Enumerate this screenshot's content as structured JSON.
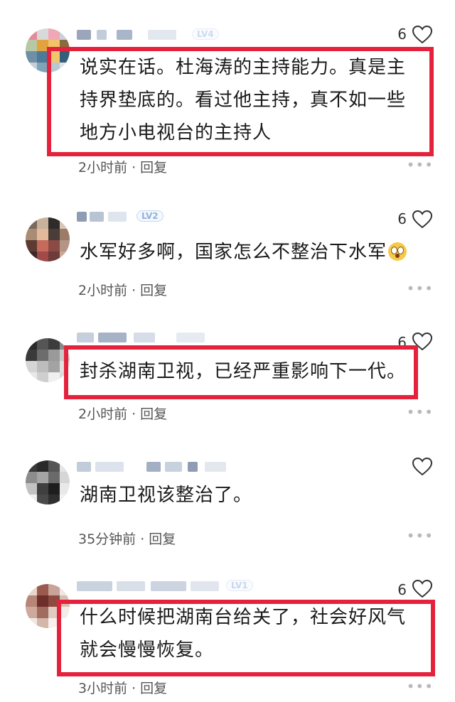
{
  "colors": {
    "highlight": "#e5223b",
    "meta_text": "#555555",
    "badge": "#8fb1de"
  },
  "comments": [
    {
      "level": "LV4",
      "likes": "6",
      "text_lines": [
        "说实在话。杜海涛的主持能力。真是主",
        "持界垫底的。看过他主持，真不如一些",
        "地方小电视台的主持人"
      ],
      "time": "2小时前",
      "dot": "·",
      "reply": "回复",
      "more": "•••",
      "highlighted": true
    },
    {
      "level": "LV2",
      "likes": "6",
      "text_lines": [
        "水军好多啊，国家怎么不整治下水军"
      ],
      "emoji": "astonished-face",
      "time": "2小时前",
      "dot": "·",
      "reply": "回复",
      "more": "•••",
      "highlighted": false
    },
    {
      "level": "",
      "likes": "6",
      "text_lines": [
        "封杀湖南卫视，已经严重影响下一代。"
      ],
      "time": "2小时前",
      "dot": "·",
      "reply": "回复",
      "more": "•••",
      "highlighted": true
    },
    {
      "level": "",
      "likes": "",
      "text_lines": [
        "湖南卫视该整治了。"
      ],
      "time": "35分钟前",
      "dot": "·",
      "reply": "回复",
      "more": "•••",
      "highlighted": false
    },
    {
      "level": "LV1",
      "likes": "6",
      "text_lines": [
        "什么时候把湖南台给关了，社会好风气",
        "就会慢慢恢复。"
      ],
      "time": "3小时前",
      "dot": "·",
      "reply": "回复",
      "more": "•••",
      "highlighted": true
    }
  ]
}
